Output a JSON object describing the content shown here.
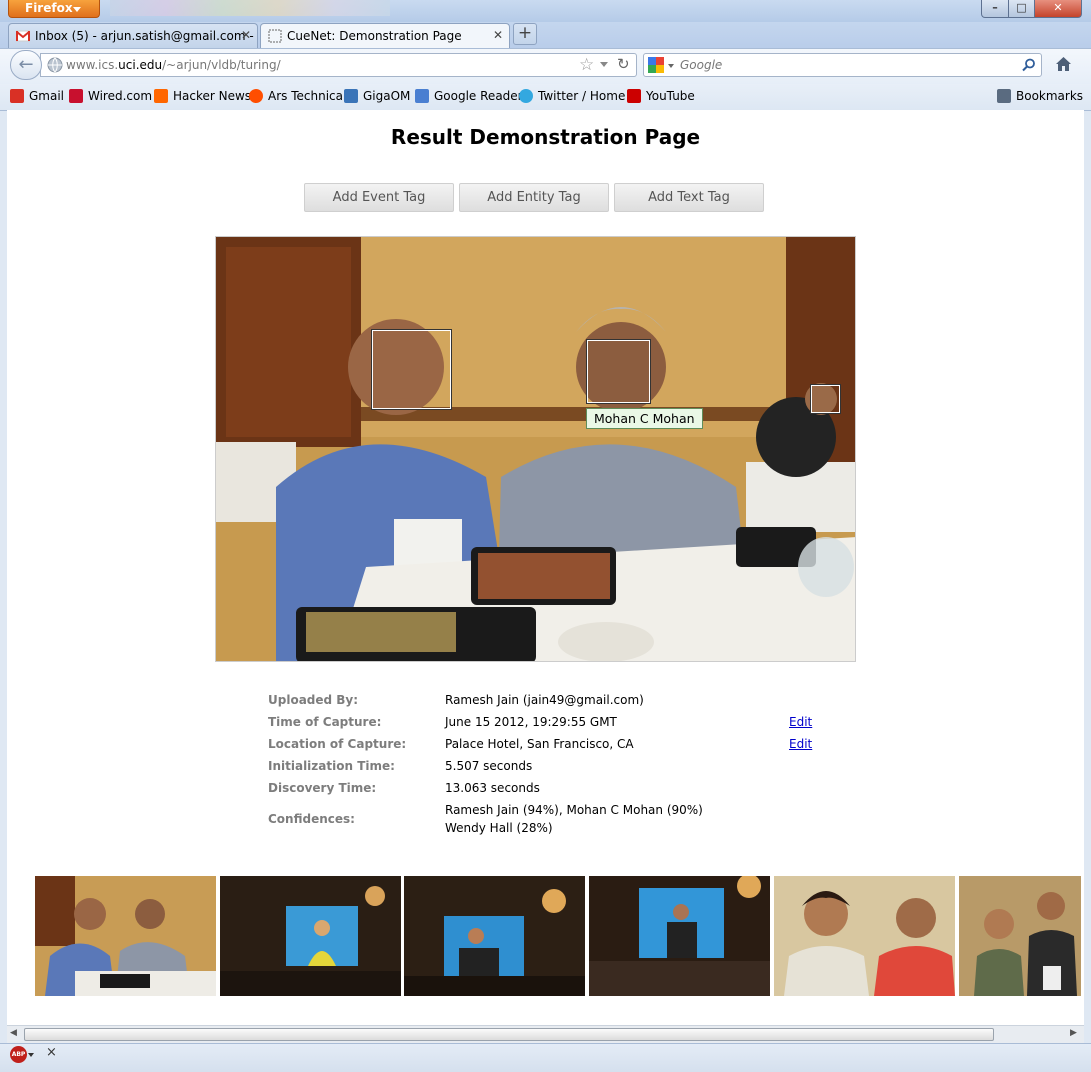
{
  "browser": {
    "app_button": "Firefox",
    "tabs": [
      {
        "label": "Inbox (5) - arjun.satish@gmail.com - ...",
        "active": false
      },
      {
        "label": "CueNet: Demonstration Page",
        "active": true
      }
    ],
    "new_tab": "+",
    "url_prefix": "www.ics.",
    "url_domain": "uci.edu",
    "url_path": "/~arjun/vldb/turing/",
    "search_placeholder": "Google",
    "bookmarks": [
      {
        "label": "Gmail",
        "icon": "gmail-icon",
        "color": "#d93025"
      },
      {
        "label": "Wired.com",
        "icon": "wired-icon",
        "color": "#c8102e"
      },
      {
        "label": "Hacker News",
        "icon": "hacker-news-icon",
        "color": "#ff6600"
      },
      {
        "label": "Ars Technica",
        "icon": "ars-icon",
        "color": "#ff4e00"
      },
      {
        "label": "GigaOM",
        "icon": "gigaom-icon",
        "color": "#3a74b8"
      },
      {
        "label": "Google Reader",
        "icon": "google-reader-icon",
        "color": "#4a7fd1"
      },
      {
        "label": "Twitter / Home",
        "icon": "twitter-icon",
        "color": "#33a8e0"
      },
      {
        "label": "YouTube",
        "icon": "youtube-icon",
        "color": "#cc0000"
      }
    ],
    "bookmarks_menu": "Bookmarks"
  },
  "page": {
    "title": "Result Demonstration Page",
    "buttons": [
      "Add Event Tag",
      "Add Entity Tag",
      "Add Text Tag"
    ],
    "face_label": "Mohan C Mohan",
    "details": [
      {
        "label": "Uploaded By:",
        "value": "Ramesh Jain (jain49@gmail.com)",
        "edit": ""
      },
      {
        "label": "Time of Capture:",
        "value": "June 15 2012, 19:29:55 GMT",
        "edit": "Edit"
      },
      {
        "label": "Location of Capture:",
        "value": "Palace Hotel, San Francisco, CA",
        "edit": "Edit"
      },
      {
        "label": "Initialization Time:",
        "value": "5.507 seconds",
        "edit": ""
      },
      {
        "label": "Discovery Time:",
        "value": "13.063 seconds",
        "edit": ""
      },
      {
        "label": "Confidences:",
        "value": "Ramesh Jain (94%), Mohan C Mohan (90%)",
        "value2": "Wendy Hall (28%)",
        "edit": ""
      }
    ]
  },
  "status": {
    "abp": "ABP",
    "close": "×"
  }
}
